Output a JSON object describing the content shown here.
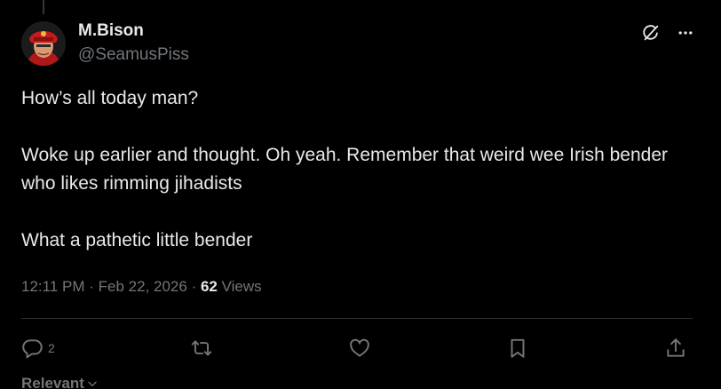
{
  "author": {
    "display_name": "M.Bison",
    "handle": "@SeamusPiss"
  },
  "icons": {
    "grok": "grok-icon",
    "more": "more-icon",
    "reply": "reply-icon",
    "retweet": "retweet-icon",
    "like": "like-icon",
    "bookmark": "bookmark-icon",
    "share": "share-icon",
    "chevron": "chevron-down-icon"
  },
  "post": {
    "lines": [
      "How’s all today man?",
      "Woke up earlier and thought. Oh yeah. Remember that weird wee Irish bender who likes rimming jihadists",
      "What a pathetic little bender"
    ],
    "time": "12:11 PM",
    "date": "Feb 22, 2026",
    "views_count": "62",
    "views_label": "Views"
  },
  "actions": {
    "reply_count": "2"
  },
  "sort": {
    "label": "Relevant"
  },
  "colors": {
    "background": "#000000",
    "text": "#e7e9ea",
    "muted": "#71767b",
    "divider": "#2f3336"
  }
}
